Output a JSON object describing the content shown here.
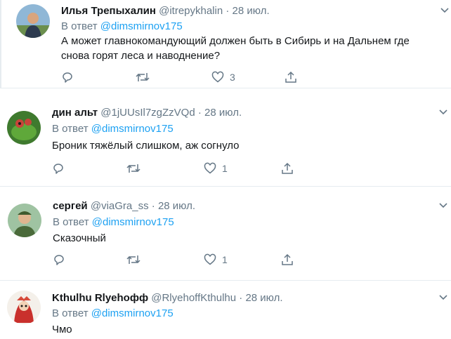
{
  "tweets": [
    {
      "name": "Илья Трепыхалин",
      "handle": "@itrepykhalin",
      "date": "28 июл.",
      "reply_prefix": "В ответ",
      "reply_to": "@dimsmirnov175",
      "text": "А может главнокомандующий должен быть в Сибирь и на Дальнем где снова горят леса и наводнение?",
      "likes": "3"
    },
    {
      "name": "дин альт",
      "handle": "@1jUUsIl7zgZzVQd",
      "date": "28 июл.",
      "reply_prefix": "В ответ",
      "reply_to": "@dimsmirnov175",
      "text": "Броник тяжёлый слишком, аж согнуло",
      "likes": "1"
    },
    {
      "name": "сергей",
      "handle": "@viaGra_ss",
      "date": "28 июл.",
      "reply_prefix": "В ответ",
      "reply_to": "@dimsmirnov175",
      "text": "Сказочный",
      "likes": "1"
    },
    {
      "name": "Kthulhu Rlyehoфф",
      "handle": "@RlyehoffKthulhu",
      "date": "28 июл.",
      "reply_prefix": "В ответ",
      "reply_to": "@dimsmirnov175",
      "text": "Чмо"
    }
  ],
  "separator": "·",
  "icons": {
    "reply": "reply-icon",
    "retweet": "retweet-icon",
    "like": "heart-icon",
    "share": "share-icon",
    "more": "chevron-down-icon"
  },
  "colors": {
    "accent": "#1da1f2",
    "muted": "#657786",
    "text": "#14171a",
    "border": "#e6ecf0"
  }
}
